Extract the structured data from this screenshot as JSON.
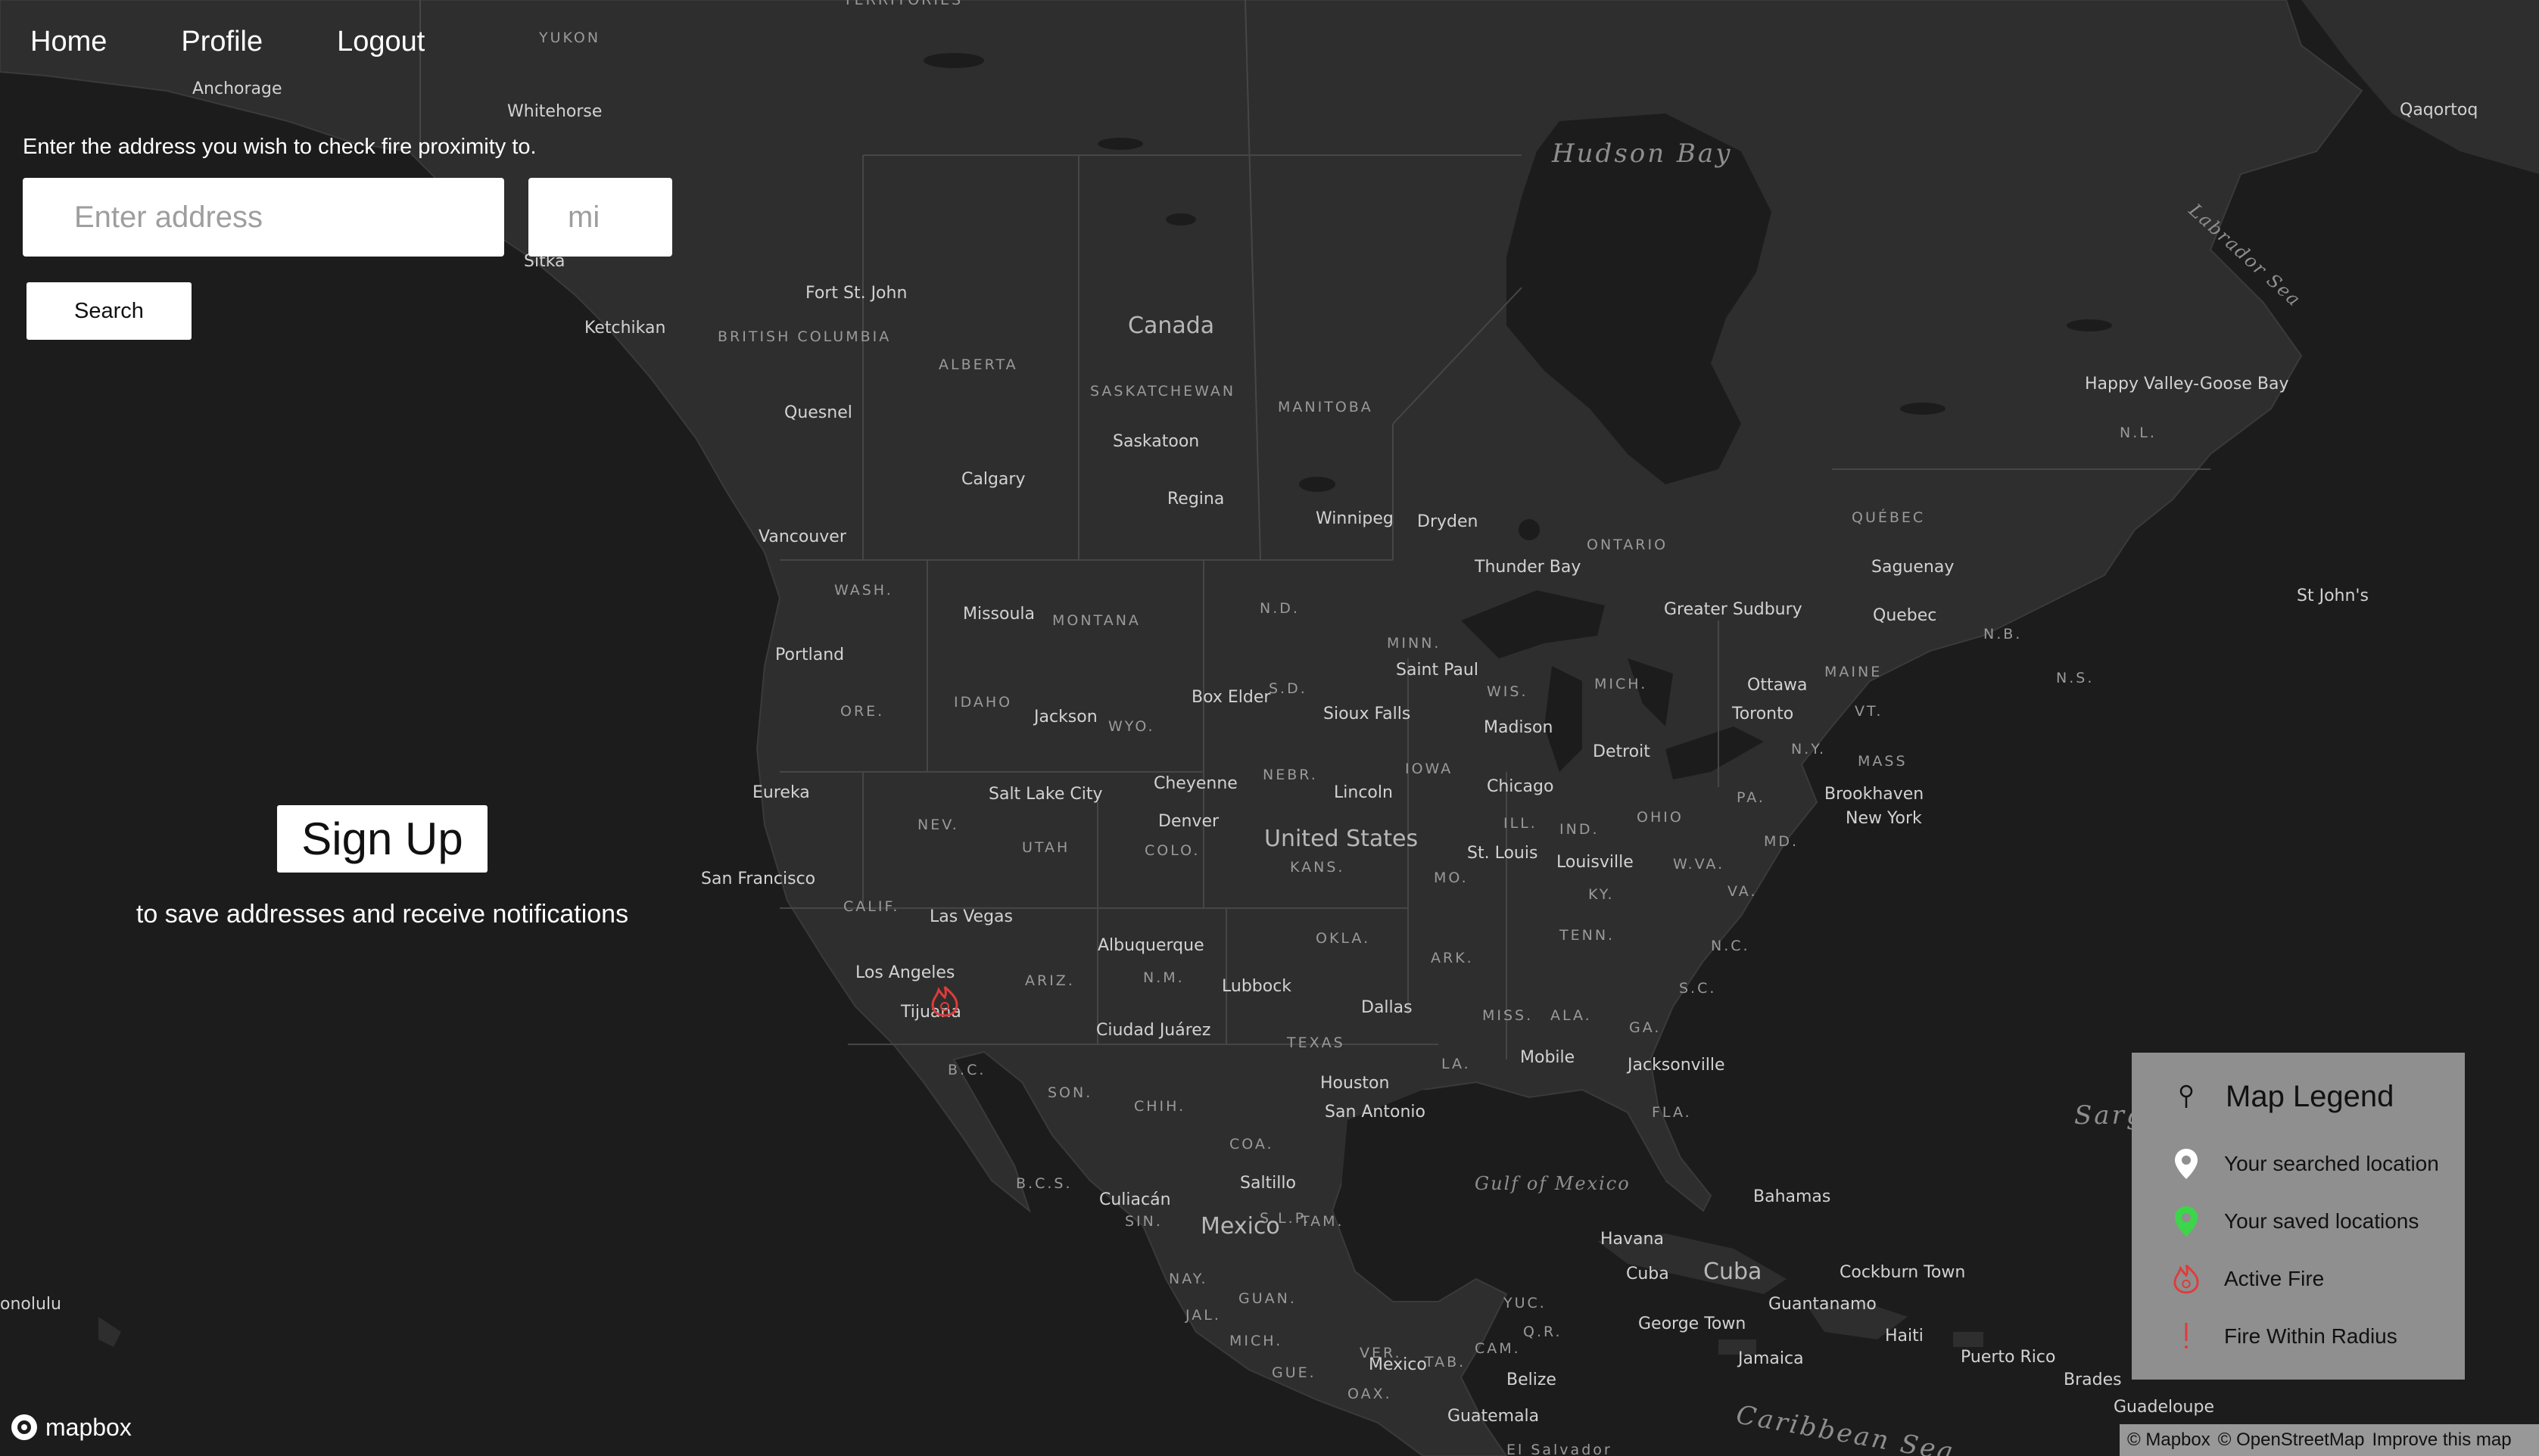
{
  "nav": {
    "home": "Home",
    "profile": "Profile",
    "logout": "Logout"
  },
  "search": {
    "prompt": "Enter the address you wish to check fire proximity to.",
    "address_placeholder": "Enter address",
    "radius_placeholder": "mi",
    "button": "Search"
  },
  "signup": {
    "button": "Sign Up",
    "note": "to save addresses and receive notifications"
  },
  "legend": {
    "title": "Map Legend",
    "header_icon": "pin-outline-icon",
    "items": [
      {
        "label": "Your searched location",
        "icon": "white-pin-icon",
        "color": "#ffffff"
      },
      {
        "label": "Your saved locations",
        "icon": "green-pin-icon",
        "color": "#3dd64a"
      },
      {
        "label": "Active Fire",
        "icon": "fire-icon",
        "color": "#e03a3a"
      },
      {
        "label": "Fire Within Radius",
        "icon": "exclamation-icon",
        "color": "#e03a3a"
      }
    ]
  },
  "attribution": {
    "mapbox": "© Mapbox",
    "osm": "© OpenStreetMap",
    "improve": "Improve this map"
  },
  "logo": {
    "text": "mapbox"
  },
  "map": {
    "fire_marker_icon": "fire-icon",
    "fire_marker_color": "#e03a3a",
    "land_color": "#2e2e2e",
    "water_color": "#1c1c1c",
    "cities": [
      "Anchorage",
      "Whitehorse",
      "Sitka",
      "Ketchikan",
      "Fort St. John",
      "Quesnel",
      "Calgary",
      "Vancouver",
      "Saskatoon",
      "Regina",
      "Winnipeg",
      "Dryden",
      "Thunder Bay",
      "Greater Sudbury",
      "Saguenay",
      "Quebec",
      "Ottawa",
      "Toronto",
      "St John's",
      "Happy Valley-Goose Bay",
      "Qaqortoq",
      "Portland",
      "Missoula",
      "Jackson",
      "Box Elder",
      "Saint Paul",
      "Sioux Falls",
      "Madison",
      "Detroit",
      "Eureka",
      "Salt Lake City",
      "Cheyenne",
      "Denver",
      "Lincoln",
      "Chicago",
      "St. Louis",
      "Louisville",
      "Brookhaven",
      "New York",
      "San Francisco",
      "Las Vegas",
      "Los Angeles",
      "Tijuana",
      "Albuquerque",
      "Lubbock",
      "Dallas",
      "Ciudad Juárez",
      "Houston",
      "San Antonio",
      "Mobile",
      "Jacksonville",
      "Culiacán",
      "Saltillo",
      "Mexico",
      "Havana",
      "Cuba",
      "Cockburn Town",
      "Guantanamo",
      "George Town",
      "Jamaica",
      "Haiti",
      "Puerto Rico",
      "Belize",
      "Guatemala",
      "Bahamas",
      "Brades",
      "Guadeloupe",
      "onolulu"
    ],
    "regions": [
      "YUKON",
      "BRITISH COLUMBIA",
      "ALBERTA",
      "SASKATCHEWAN",
      "MANITOBA",
      "ONTARIO",
      "QUÉBEC",
      "N.L.",
      "N.B.",
      "N.S.",
      "WASH.",
      "MONTANA",
      "N.D.",
      "MINN.",
      "ORE.",
      "IDAHO",
      "WYO.",
      "S.D.",
      "WIS.",
      "MICH.",
      "MAINE",
      "VT.",
      "N.Y.",
      "MASS",
      "NEV.",
      "UTAH",
      "COLO.",
      "NEBR.",
      "IOWA",
      "ILL.",
      "IND.",
      "OHIO",
      "PA.",
      "MD.",
      "CALIF.",
      "KANS.",
      "MO.",
      "KY.",
      "W.VA.",
      "VA.",
      "ARIZ.",
      "N.M.",
      "OKLA.",
      "TENN.",
      "N.C.",
      "ARK.",
      "S.C.",
      "TEXAS",
      "MISS.",
      "ALA.",
      "GA.",
      "LA.",
      "FLA.",
      "B.C.",
      "SON.",
      "CHIH.",
      "COA.",
      "B.C.S.",
      "SIN.",
      "TAM.",
      "S.L.P.",
      "NAY.",
      "GUAN.",
      "JAL.",
      "MICH.",
      "YUC.",
      "Q.R.",
      "CAM.",
      "TAB.",
      "VER.",
      "GUE.",
      "OAX.",
      "TERRITORIES",
      "El Salvador"
    ],
    "countries": [
      "Canada",
      "United States",
      "Mexico",
      "Cuba"
    ],
    "water": [
      "Hudson Bay",
      "Labrador Sea",
      "Sargasso Sea",
      "Gulf of Mexico",
      "Caribbean Sea"
    ]
  }
}
